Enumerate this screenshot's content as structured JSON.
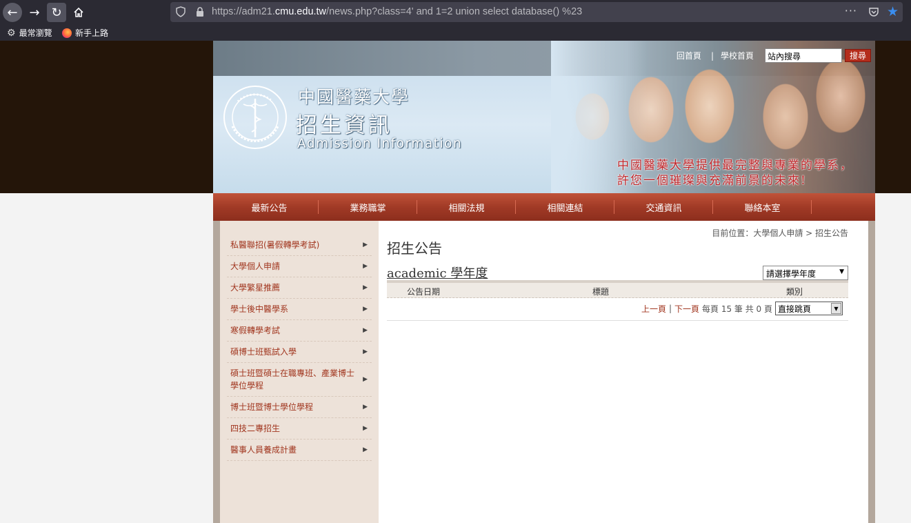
{
  "browser": {
    "url_prefix": "https://adm21.",
    "url_host": "cmu.edu.tw",
    "url_suffix": "/news.php?class=4' and 1=2 union select database() %23",
    "more_icon": "···",
    "bookmarks": [
      {
        "label": "最常瀏覽",
        "icon": "gear-icon"
      },
      {
        "label": "新手上路",
        "icon": "firefox-icon"
      }
    ]
  },
  "header": {
    "top_links": [
      "回首頁",
      "學校首頁"
    ],
    "separator": "|",
    "search_placeholder": "站內搜尋",
    "search_button": "搜尋",
    "univ_name": "中國醫藥大學",
    "section_title": "招生資訊",
    "section_title_en": "Admission Information",
    "slogan_line1": "中國醫藥大學提供最完整與專業的學系，",
    "slogan_line2": "許您一個璀璨與充滿前景的未來!"
  },
  "nav": [
    "最新公告",
    "業務職掌",
    "相關法規",
    "相關連結",
    "交通資訊",
    "聯絡本室"
  ],
  "sidebar": [
    "私醫聯招(暑假轉學考試)",
    "大學個人申請",
    "大學繁星推薦",
    "學士後中醫學系",
    "寒假轉學考試",
    "碩博士班甄試入學",
    "碩士班暨碩士在職專班、產業博士學位學程",
    "博士班暨博士學位學程",
    "四技二專招生",
    "醫事人員養成計畫"
  ],
  "main": {
    "breadcrumb": "目前位置：大學個人申請 > 招生公告",
    "page_title": "招生公告",
    "year_title": "academic 學年度",
    "year_select": "請選擇學年度",
    "columns": [
      "公告日期",
      "標題",
      "類別"
    ],
    "pager": {
      "prev": "上一頁",
      "sep": "|",
      "next": "下一頁",
      "info": "每頁 15 筆 共 0 頁",
      "jump": "直接跳頁"
    }
  },
  "colors": {
    "brand_red": "#a13a26",
    "link_red": "#a1361f",
    "band_dark": "#241509"
  }
}
